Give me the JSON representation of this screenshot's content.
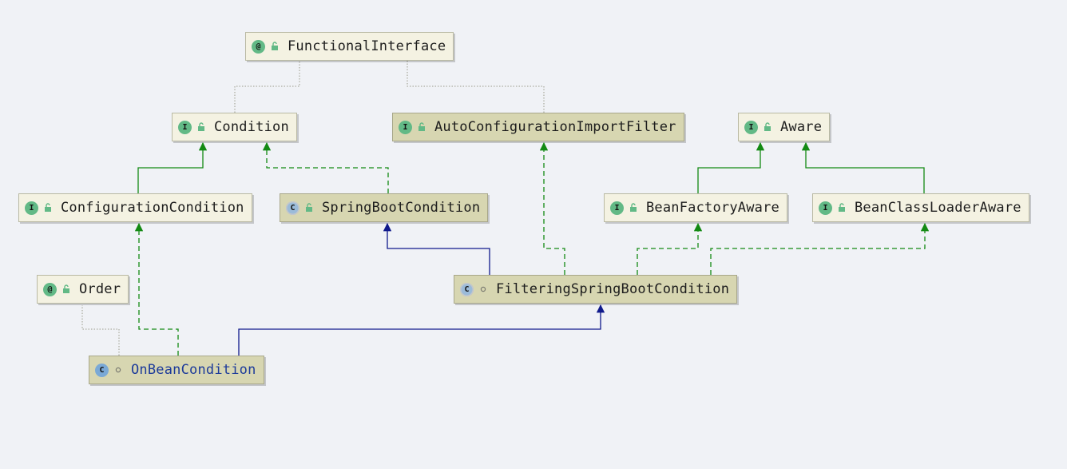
{
  "diagram": {
    "nodes": [
      {
        "id": "functional-interface",
        "kind": "a",
        "kind_label": "@",
        "modifier": "public",
        "label": "FunctionalInterface",
        "selected": false
      },
      {
        "id": "condition",
        "kind": "i",
        "kind_label": "I",
        "modifier": "public",
        "label": "Condition",
        "selected": false
      },
      {
        "id": "auto-configuration-import-filter",
        "kind": "i",
        "kind_label": "I",
        "modifier": "public",
        "label": "AutoConfigurationImportFilter",
        "selected": true
      },
      {
        "id": "aware",
        "kind": "i",
        "kind_label": "I",
        "modifier": "public",
        "label": "Aware",
        "selected": false
      },
      {
        "id": "configuration-condition",
        "kind": "i",
        "kind_label": "I",
        "modifier": "public",
        "label": "ConfigurationCondition",
        "selected": false
      },
      {
        "id": "spring-boot-condition",
        "kind": "c",
        "abstract": true,
        "kind_label": "C",
        "modifier": "public",
        "label": "SpringBootCondition",
        "selected": true
      },
      {
        "id": "bean-factory-aware",
        "kind": "i",
        "kind_label": "I",
        "modifier": "public",
        "label": "BeanFactoryAware",
        "selected": false
      },
      {
        "id": "bean-class-loader-aware",
        "kind": "i",
        "kind_label": "I",
        "modifier": "public",
        "label": "BeanClassLoaderAware",
        "selected": false
      },
      {
        "id": "order",
        "kind": "a",
        "kind_label": "@",
        "modifier": "public",
        "label": "Order",
        "selected": false
      },
      {
        "id": "filtering-spring-boot-condition",
        "kind": "c",
        "abstract": true,
        "kind_label": "C",
        "modifier": "package",
        "label": "FilteringSpringBootCondition",
        "selected": true
      },
      {
        "id": "on-bean-condition",
        "kind": "c",
        "kind_label": "C",
        "modifier": "package",
        "label": "OnBeanCondition",
        "selected": true,
        "label_color": "blue"
      }
    ],
    "edges": [
      {
        "from": "condition",
        "to": "functional-interface",
        "type": "annotated"
      },
      {
        "from": "auto-configuration-import-filter",
        "to": "functional-interface",
        "type": "annotated"
      },
      {
        "from": "configuration-condition",
        "to": "condition",
        "type": "extends-interface"
      },
      {
        "from": "spring-boot-condition",
        "to": "condition",
        "type": "implements"
      },
      {
        "from": "bean-factory-aware",
        "to": "aware",
        "type": "extends-interface"
      },
      {
        "from": "bean-class-loader-aware",
        "to": "aware",
        "type": "extends-interface"
      },
      {
        "from": "filtering-spring-boot-condition",
        "to": "spring-boot-condition",
        "type": "extends-class"
      },
      {
        "from": "filtering-spring-boot-condition",
        "to": "auto-configuration-import-filter",
        "type": "implements"
      },
      {
        "from": "filtering-spring-boot-condition",
        "to": "bean-factory-aware",
        "type": "implements"
      },
      {
        "from": "filtering-spring-boot-condition",
        "to": "bean-class-loader-aware",
        "type": "implements"
      },
      {
        "from": "on-bean-condition",
        "to": "order",
        "type": "annotated"
      },
      {
        "from": "on-bean-condition",
        "to": "configuration-condition",
        "type": "implements"
      },
      {
        "from": "on-bean-condition",
        "to": "filtering-spring-boot-condition",
        "type": "extends-class"
      }
    ]
  },
  "colors": {
    "background": "#f0f2f6",
    "implements": "#138a13",
    "extends_class": "#101a8c",
    "annotated": "#9a9a8a"
  }
}
